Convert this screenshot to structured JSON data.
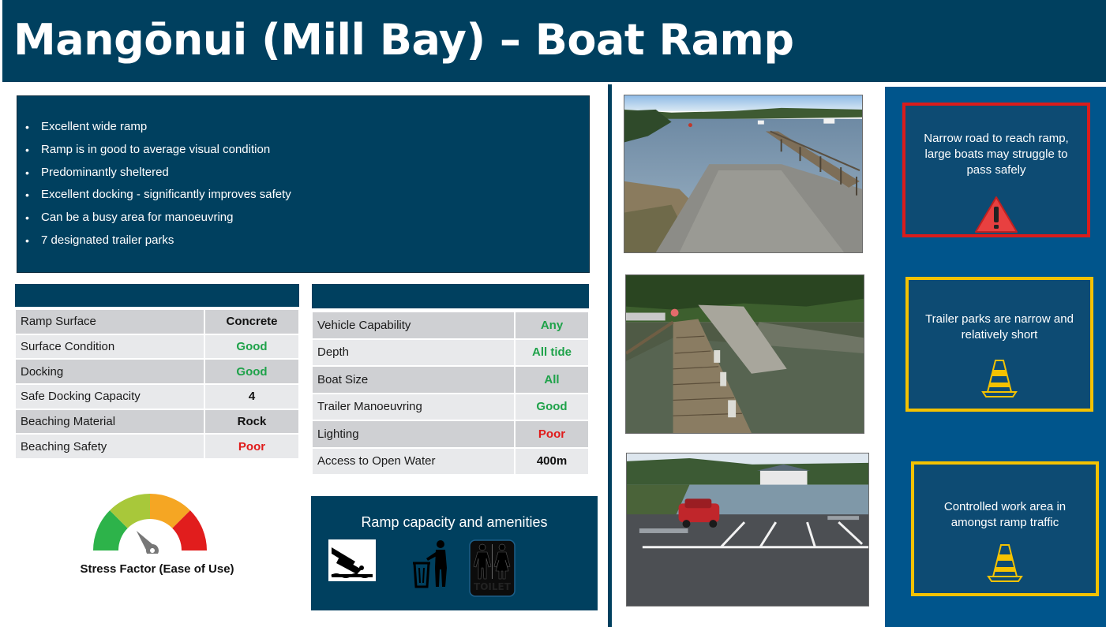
{
  "title": "Mangōnui (Mill Bay) – Boat Ramp",
  "summary": [
    "Excellent wide ramp",
    "Ramp is in good to average visual condition",
    "Predominantly sheltered",
    "Excellent docking - significantly improves safety",
    "Can be a busy area for manoeuvring",
    "7 designated trailer parks"
  ],
  "ramp_table": [
    {
      "label": "Ramp Surface",
      "value": "Concrete",
      "color": "#111111"
    },
    {
      "label": "Surface Condition",
      "value": "Good",
      "color": "#1fa24a"
    },
    {
      "label": "Docking",
      "value": "Good",
      "color": "#1fa24a"
    },
    {
      "label": "Safe Docking Capacity",
      "value": "4",
      "color": "#111111"
    },
    {
      "label": "Beaching Material",
      "value": "Rock",
      "color": "#111111"
    },
    {
      "label": "Beaching Safety",
      "value": "Poor",
      "color": "#e01b1b"
    }
  ],
  "access_table": [
    {
      "label": "Vehicle Capability",
      "value": "Any",
      "color": "#1fa24a"
    },
    {
      "label": "Depth",
      "value": "All tide",
      "color": "#1fa24a"
    },
    {
      "label": "Boat Size",
      "value": "All",
      "color": "#1fa24a"
    },
    {
      "label": "Trailer Manoeuvring",
      "value": "Good",
      "color": "#1fa24a"
    },
    {
      "label": "Lighting",
      "value": "Poor",
      "color": "#e01b1b"
    },
    {
      "label": "Access to Open Water",
      "value": "400m",
      "color": "#111111"
    }
  ],
  "stress": {
    "label": "Stress Factor (Ease of Use)",
    "level_fraction": 0.38,
    "segment_colors": [
      "#2db34a",
      "#a8c83a",
      "#f5a623",
      "#e11d1d"
    ]
  },
  "amenities": {
    "title": "Ramp capacity and amenities",
    "icons": [
      "boat-ramp-icon",
      "rubbish-bin-icon",
      "toilet-icon"
    ],
    "toilet_text": "TOILET"
  },
  "warnings": [
    {
      "text": "Narrow road to reach ramp, large boats may struggle to pass safely",
      "icon": "warning-triangle-icon",
      "border": "red"
    },
    {
      "text": "Trailer parks are narrow and relatively short",
      "icon": "traffic-cone-icon",
      "border": "yellow"
    },
    {
      "text": "Controlled work area in amongst ramp traffic",
      "icon": "traffic-cone-icon",
      "border": "yellow"
    }
  ],
  "colors": {
    "navy": "#00405f",
    "panel_blue": "#00558c",
    "good": "#1fa24a",
    "poor": "#e01b1b",
    "warn_red": "#d91c1c",
    "warn_yellow": "#f4c200"
  }
}
